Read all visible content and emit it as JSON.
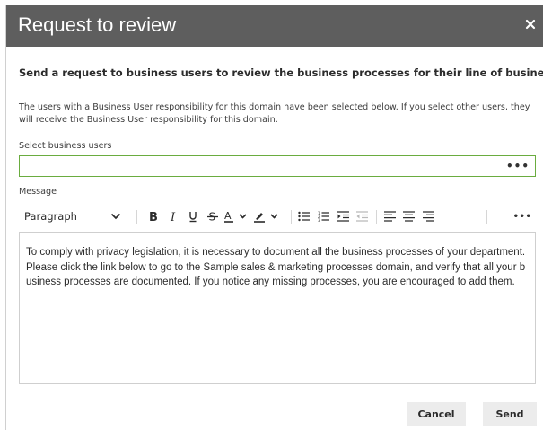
{
  "dialog": {
    "title": "Request to review",
    "close_icon": "close-icon"
  },
  "content": {
    "lead": "Send a request to business users to review the business processes for their line of business.",
    "info": "The users with a Business User responsibility for this domain have been selected below. If you select other users, they will receive the Business User responsibility for this domain."
  },
  "users_field": {
    "label": "Select business users",
    "value": "",
    "placeholder": "",
    "more_label": "•••",
    "accent_color": "#6aac3f"
  },
  "message_field": {
    "label": "Message",
    "toolbar": {
      "block_format": "Paragraph",
      "icons": [
        "chevron-down-icon",
        "bold-icon",
        "italic-icon",
        "underline-icon",
        "strikethrough-icon",
        "text-color-icon",
        "highlight-color-icon",
        "bullet-list-icon",
        "numbered-list-icon",
        "indent-icon",
        "outdent-icon",
        "align-left-icon",
        "align-center-icon",
        "align-right-icon",
        "more-icon"
      ],
      "more_label": "•••"
    },
    "body": "To comply with privacy legislation, it is necessary to document all the business processes of your department. Please click the link below to go to the Sample sales & marketing processes domain, and verify that all your business processes are documented. If you notice any missing processes, you are encouraged to add them."
  },
  "footer": {
    "cancel_label": "Cancel",
    "send_label": "Send"
  },
  "colors": {
    "titlebar": "#5e5e5e",
    "button_bg": "#ececec"
  }
}
